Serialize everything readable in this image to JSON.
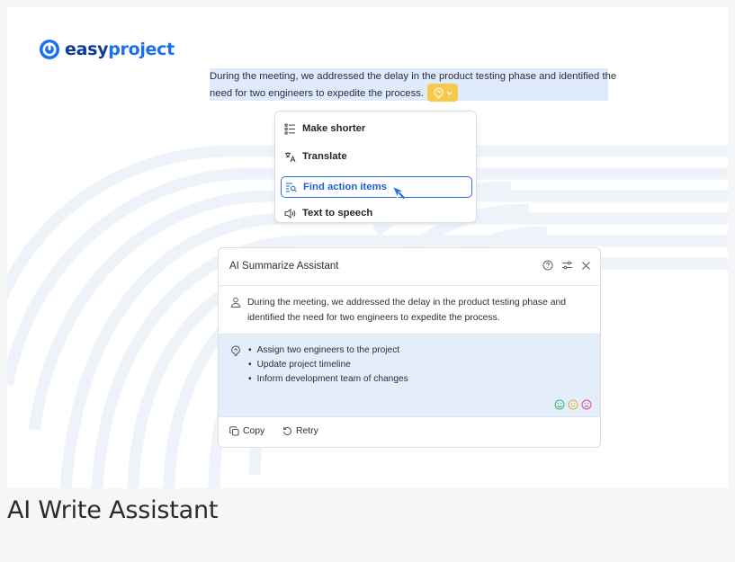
{
  "brand": {
    "name_part1": "easy",
    "name_part2": "project",
    "accent": "#1d6ff2",
    "dark": "#0d3a9c"
  },
  "editor": {
    "selected_text": "During the meeting, we addressed the delay in the product testing phase and identified the need for two engineers to expedite the process.",
    "highlight_color": "#dfeafc",
    "ai_button": {
      "icon": "ai-spark-icon",
      "chevron": "chevron-down-icon",
      "color": "#f7c948"
    }
  },
  "menu": {
    "items": [
      {
        "label": "Make shorter",
        "icon": "shorten-icon",
        "active": false
      },
      {
        "label": "Translate",
        "icon": "translate-icon",
        "active": false
      },
      {
        "label": "Find action items",
        "icon": "find-items-icon",
        "active": true
      },
      {
        "label": "Text to speech",
        "icon": "speaker-icon",
        "active": false
      }
    ]
  },
  "assistant": {
    "title": "AI Summarize Assistant",
    "header_icons": [
      "help-icon",
      "settings-sliders-icon",
      "close-icon"
    ],
    "prompt_text": "During the meeting, we addressed the delay in the product testing phase and identified the need for two engineers to expedite the process.",
    "result_items": [
      "Assign two engineers to the project",
      "Update project timeline",
      "Inform development team of changes"
    ],
    "rating_icons": [
      "smile-green-icon",
      "neutral-yellow-icon",
      "frown-red-icon"
    ],
    "actions": {
      "copy": "Copy",
      "retry": "Retry"
    }
  },
  "caption": "AI Write Assistant"
}
